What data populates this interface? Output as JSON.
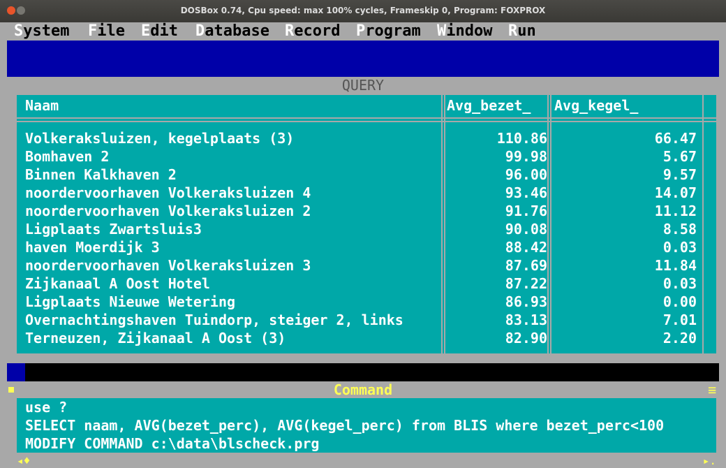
{
  "window": {
    "title": "DOSBox 0.74, Cpu speed: max 100% cycles, Frameskip  0, Program:  FOXPROX"
  },
  "menu": [
    {
      "hot": "S",
      "rest": "ystem"
    },
    {
      "hot": "F",
      "rest": "ile"
    },
    {
      "hot": "E",
      "rest": "dit"
    },
    {
      "hot": "D",
      "rest": "atabase"
    },
    {
      "hot": "R",
      "rest": "ecord"
    },
    {
      "hot": "P",
      "rest": "rogram"
    },
    {
      "hot": "W",
      "rest": "indow"
    },
    {
      "hot": "R",
      "rest": "un"
    }
  ],
  "query": {
    "title": "QUERY",
    "columns": [
      "Naam",
      "Avg_bezet_",
      "Avg_kegel_"
    ],
    "rows": [
      {
        "naam": "Volkeraksluizen, kegelplaats (3)",
        "avg_bezet": "110.86",
        "avg_kegel": "66.47"
      },
      {
        "naam": "Bomhaven 2",
        "avg_bezet": "99.98",
        "avg_kegel": "5.67"
      },
      {
        "naam": "Binnen Kalkhaven 2",
        "avg_bezet": "96.00",
        "avg_kegel": "9.57"
      },
      {
        "naam": "noordervoorhaven Volkeraksluizen 4",
        "avg_bezet": "93.46",
        "avg_kegel": "14.07"
      },
      {
        "naam": "noordervoorhaven Volkeraksluizen 2",
        "avg_bezet": "91.76",
        "avg_kegel": "11.12"
      },
      {
        "naam": "Ligplaats Zwartsluis3",
        "avg_bezet": "90.08",
        "avg_kegel": "8.58"
      },
      {
        "naam": "haven Moerdijk 3",
        "avg_bezet": "88.42",
        "avg_kegel": "0.03"
      },
      {
        "naam": "noordervoorhaven Volkeraksluizen 3",
        "avg_bezet": "87.69",
        "avg_kegel": "11.84"
      },
      {
        "naam": "Zijkanaal A Oost Hotel",
        "avg_bezet": "87.22",
        "avg_kegel": "0.03"
      },
      {
        "naam": "Ligplaats Nieuwe Wetering",
        "avg_bezet": "86.93",
        "avg_kegel": "0.00"
      },
      {
        "naam": "Overnachtingshaven Tuindorp, steiger 2, links",
        "avg_bezet": "83.13",
        "avg_kegel": "7.01"
      },
      {
        "naam": "Terneuzen, Zijkanaal A Oost (3)",
        "avg_bezet": "82.90",
        "avg_kegel": "2.20"
      }
    ]
  },
  "command": {
    "title": "Command",
    "lines": [
      "use ?",
      "SELECT naam, AVG(bezet_perc), AVG(kegel_perc) from BLIS where bezet_perc<100",
      "MODIFY COMMAND c:\\data\\blscheck.prg"
    ]
  },
  "icons": {
    "close": "close-box-icon",
    "menu": "window-menu-icon",
    "scroll_left": "scroll-left-arrows-icon",
    "scroll_right": "scroll-right-arrow-icon"
  },
  "colors": {
    "dos_blue": "#0000a8",
    "dos_cyan": "#00a8a8",
    "dos_gray": "#a8a8a8",
    "dos_yellow": "#ffff55"
  }
}
